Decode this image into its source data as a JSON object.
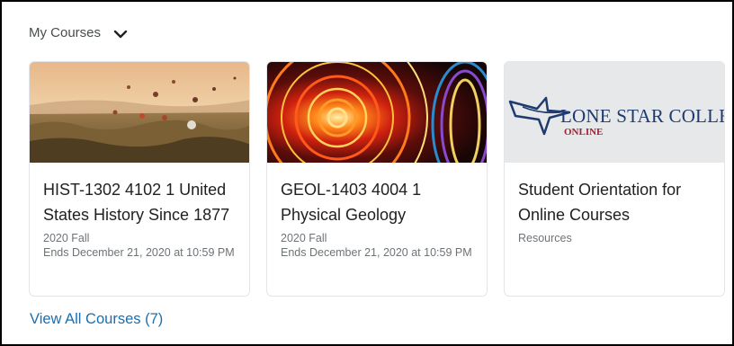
{
  "widget": {
    "title": "My Courses",
    "view_all_label": "View All Courses (7)"
  },
  "courses": [
    {
      "title": "HIST-1302 4102 1 United States History Since 1877",
      "term": "2020 Fall",
      "ends": "Ends December 21, 2020 at 10:59 PM",
      "image": "hot-air-balloons-landscape"
    },
    {
      "title": "GEOL-1403 4004 1 Physical Geology",
      "term": "2020 Fall",
      "ends": "Ends December 21, 2020 at 10:59 PM",
      "image": "ferris-wheel-lights"
    },
    {
      "title": "Student Orientation for Online Courses",
      "term": "Resources",
      "ends": "",
      "image": "lone-star-college-logo",
      "logo_text": "LONE STAR COLLEGE",
      "logo_subtext": "ONLINE"
    }
  ],
  "colors": {
    "link": "#1a6faf",
    "logo_navy": "#1f3a6e",
    "logo_red": "#a31f34",
    "image_placeholder_bg": "#e6e8ea"
  }
}
